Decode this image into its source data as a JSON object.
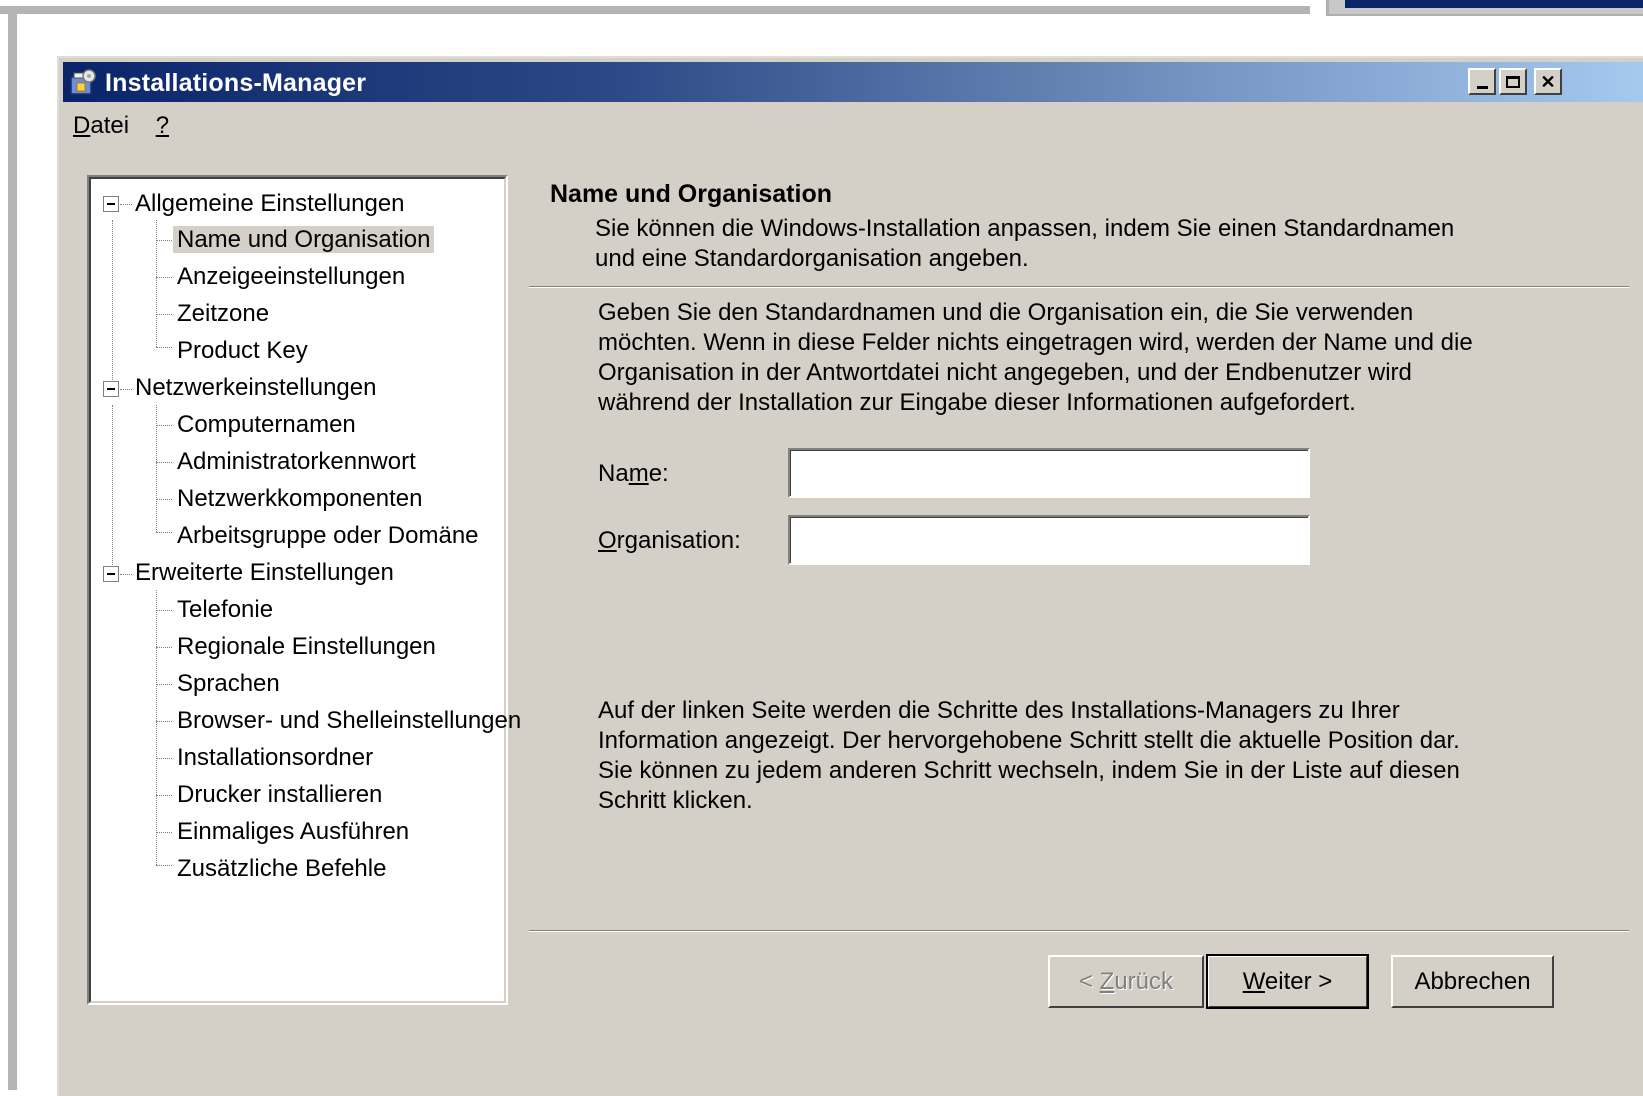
{
  "window": {
    "title": "Installations-Manager"
  },
  "menu": {
    "file_accel": "D",
    "file_rest": "atei",
    "help": "?"
  },
  "tree": {
    "groups": [
      {
        "label": "Allgemeine Einstellungen",
        "items": [
          "Name und Organisation",
          "Anzeigeeinstellungen",
          "Zeitzone",
          "Product Key"
        ]
      },
      {
        "label": "Netzwerkeinstellungen",
        "items": [
          "Computernamen",
          "Administratorkennwort",
          "Netzwerkkomponenten",
          "Arbeitsgruppe oder Domäne"
        ]
      },
      {
        "label": "Erweiterte Einstellungen",
        "items": [
          "Telefonie",
          "Regionale Einstellungen",
          "Sprachen",
          "Browser- und Shelleinstellungen",
          "Installationsordner",
          "Drucker installieren",
          "Einmaliges Ausführen",
          "Zusätzliche Befehle"
        ]
      }
    ],
    "selected": "Name und Organisation"
  },
  "content": {
    "title": "Name und Organisation",
    "description": "Sie können die Windows-Installation anpassen, indem Sie einen Standardnamen und eine Standardorganisation angeben.",
    "intro": "Geben Sie den Standardnamen und die Organisation ein, die Sie verwenden möchten. Wenn in diese Felder nichts eingetragen wird, werden der Name und die Organisation in der Antwortdatei nicht angegeben, und der Endbenutzer wird während der Installation zur Eingabe dieser Informationen aufgefordert.",
    "name_label_pre": "Na",
    "name_label_accel": "m",
    "name_label_post": "e:",
    "name_value": "",
    "org_label_accel": "O",
    "org_label_post": "rganisation:",
    "org_value": "",
    "info": "Auf der linken Seite werden die Schritte des Installations-Managers zu Ihrer Information angezeigt. Der hervorgehobene Schritt stellt die aktuelle Position dar. Sie können zu jedem anderen Schritt wechseln, indem Sie in der Liste auf diesen Schritt klicken."
  },
  "buttons": {
    "back_pre": "< ",
    "back_accel": "Z",
    "back_post": "urück",
    "next_accel": "W",
    "next_post": "eiter >",
    "cancel": "Abbrechen"
  }
}
